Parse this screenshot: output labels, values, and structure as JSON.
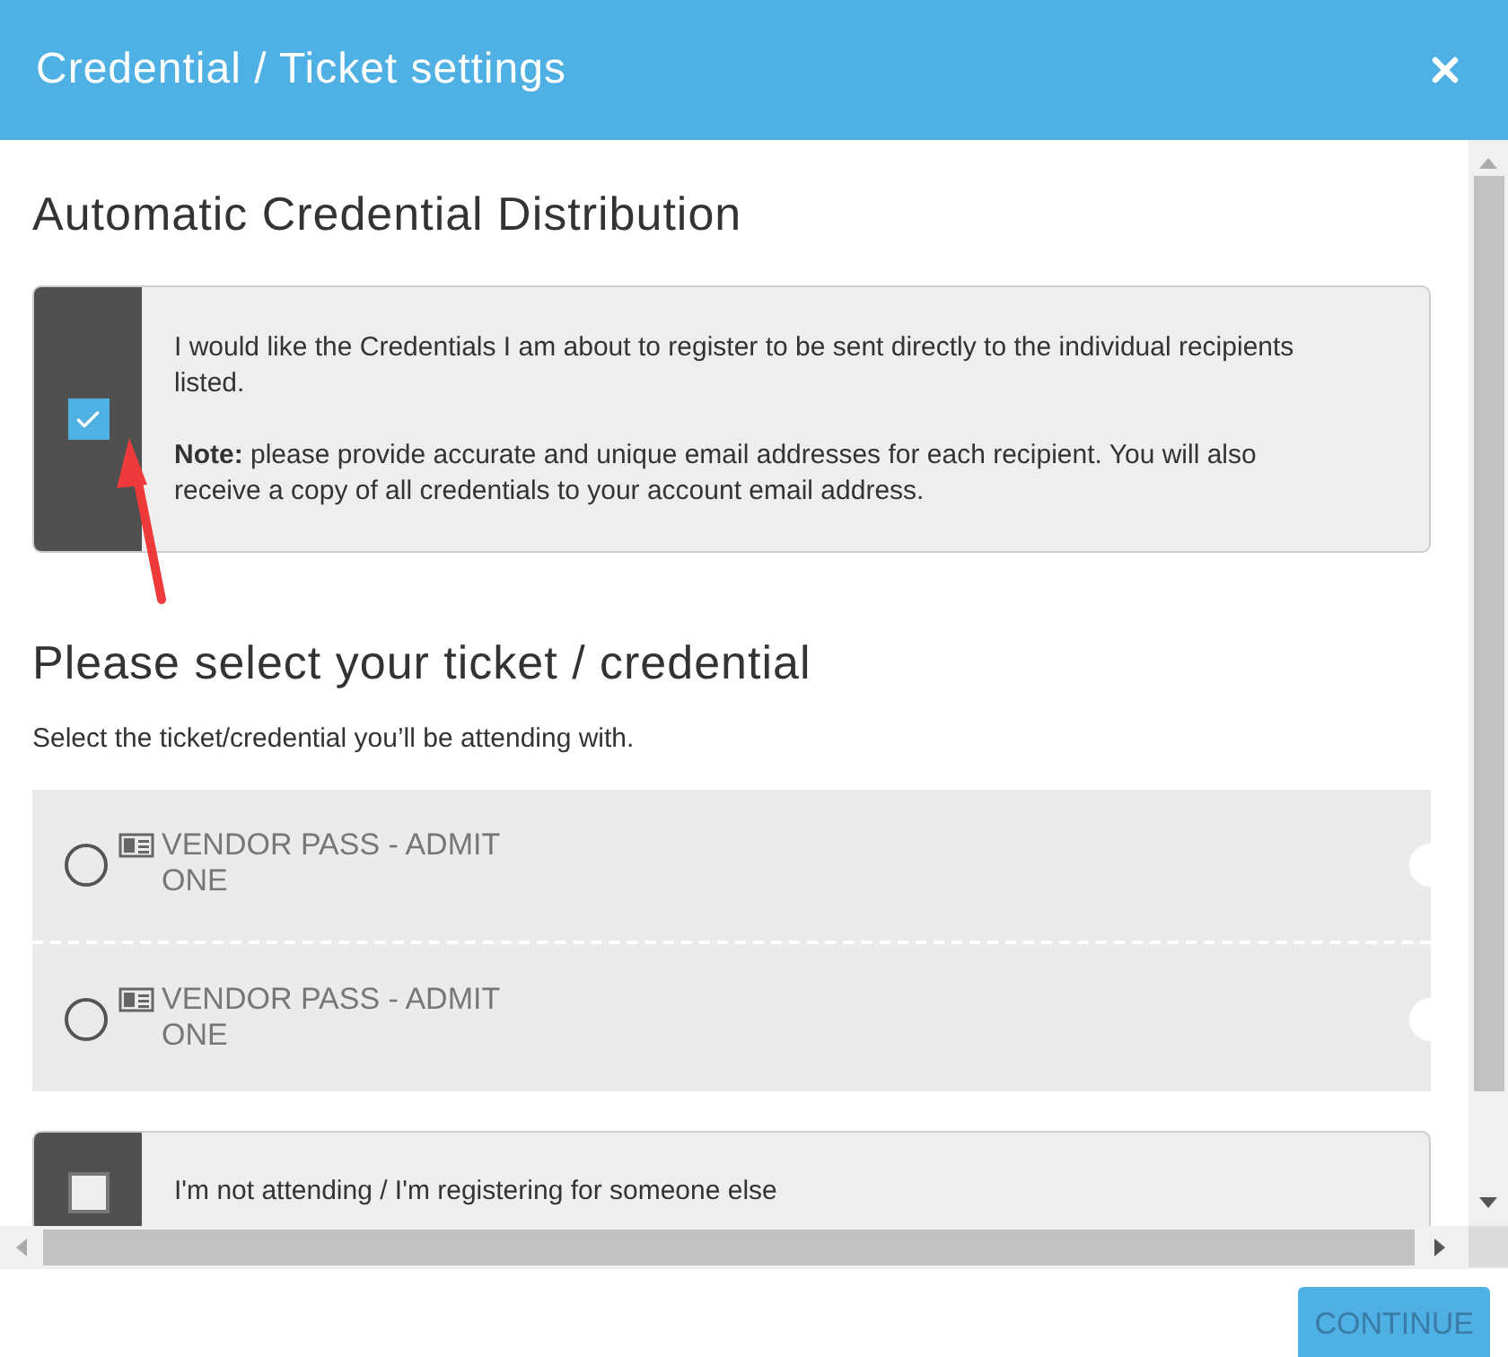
{
  "window": {
    "title": "Credential / Ticket settings"
  },
  "distribution": {
    "heading": "Automatic Credential Distribution",
    "checked": true,
    "text": "I would like the Credentials I am about to register to be sent directly to the individual recipients listed.",
    "note": "**Note:** please provide accurate and unique email addresses for each recipient. You will also receive a copy of all credentials to your account email address."
  },
  "ticket_section": {
    "heading": "Please select your ticket / credential",
    "subtext": "Select the ticket/credential you’ll be attending with.",
    "tickets": [
      {
        "label": "VENDOR PASS - ADMIT ONE",
        "selected": false
      },
      {
        "label": "VENDOR PASS - ADMIT ONE",
        "selected": false
      }
    ]
  },
  "not_attending": {
    "label": "I'm not attending / I'm registering for someone else",
    "checked": false
  },
  "buttons": [
    "CONTINUE"
  ]
}
